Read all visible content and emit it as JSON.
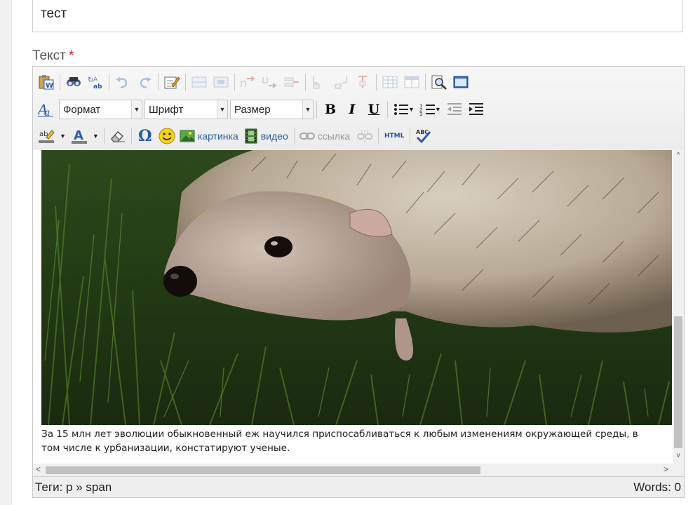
{
  "title_field": {
    "value": "тест"
  },
  "body_field": {
    "label": "Текст",
    "required_mark": "*"
  },
  "toolbar": {
    "row1": [
      "paste-word-icon",
      "find-icon",
      "replace-icon",
      "undo-icon",
      "redo-icon",
      "edit-icon",
      "table-row-icon",
      "table-col-icon",
      "split-cells-icon",
      "merge-cells-icon",
      "delete-cell-icon",
      "insert-row-icon",
      "insert-col-icon",
      "delete-col-icon",
      "table-props-icon",
      "cell-props-icon",
      "preview-icon",
      "fullscreen-icon"
    ],
    "format_label": "Формат",
    "font_label": "Шрифт",
    "size_label": "Размер",
    "bold_label": "B",
    "italic_label": "I",
    "underline_label": "U",
    "image_label": "картинка",
    "video_label": "видео",
    "link_label": "ссылка",
    "html_label": "HTML",
    "spell_label": "ABC",
    "omega_label": "Ω"
  },
  "content": {
    "caption": "За 15 млн лет эволюции обыкновенный еж научился приспосабливаться к любым изменениям окружающей среды, в том числе к урбанизации, констатируют ученые.",
    "image_alt": "hedgehog-photo"
  },
  "statusbar": {
    "path": "Теги: p » span",
    "words": "Words: 0"
  },
  "colors": {
    "required": "#d21f1f",
    "link": "#2a5d9f"
  }
}
